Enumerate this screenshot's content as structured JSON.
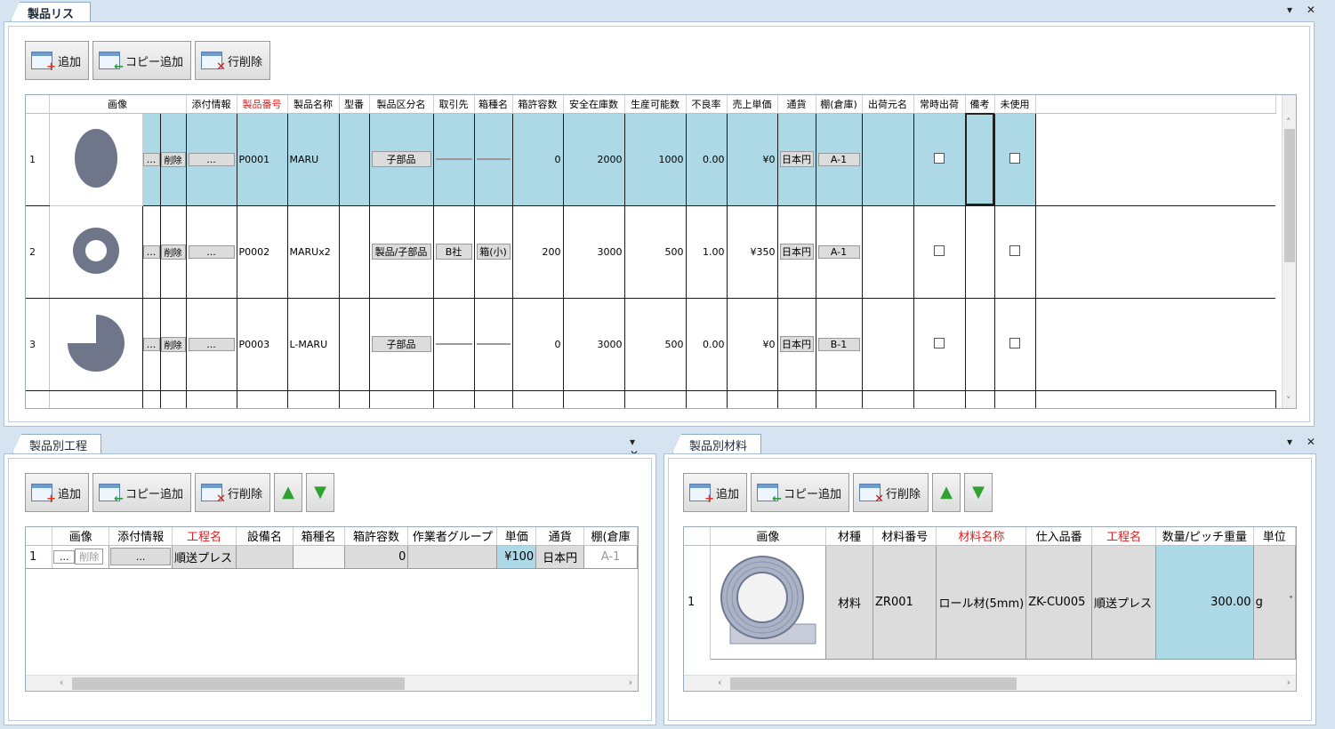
{
  "top_panel": {
    "title": "製品リスト",
    "controls": "▾ ✕",
    "toolbar": {
      "add": "追加",
      "copy_add": "コピー追加",
      "delete_row": "行削除"
    },
    "columns": [
      "画像",
      "添付情報",
      "製品番号",
      "製品名称",
      "型番",
      "製品区分名",
      "取引先",
      "箱種名",
      "箱許容数",
      "安全在庫数",
      "生産可能数",
      "不良率",
      "売上単価",
      "通貨",
      "棚(倉庫)",
      "出荷元名",
      "常時出荷",
      "備考",
      "未使用"
    ],
    "cell_buttons": {
      "ellipsis": "...",
      "delete": "削除"
    },
    "rows": [
      {
        "no": "1",
        "shape": "ellipse",
        "code": "P0001",
        "name": "MARU",
        "model": "",
        "category": "子部品",
        "partner": "",
        "box": "",
        "box_cap": "0",
        "safety": "2000",
        "capacity": "1000",
        "defect": "0.00",
        "price": "¥0",
        "currency": "日本円",
        "shelf": "A-1"
      },
      {
        "no": "2",
        "shape": "ring",
        "code": "P0002",
        "name": "MARUx2",
        "model": "",
        "category": "製品/子部品",
        "partner": "B社",
        "box": "箱(小)",
        "box_cap": "200",
        "safety": "3000",
        "capacity": "500",
        "defect": "1.00",
        "price": "¥350",
        "currency": "日本円",
        "shelf": "A-1"
      },
      {
        "no": "3",
        "shape": "pacman",
        "code": "P0003",
        "name": "L-MARU",
        "model": "",
        "category": "子部品",
        "partner": "",
        "box": "",
        "box_cap": "0",
        "safety": "3000",
        "capacity": "500",
        "defect": "0.00",
        "price": "¥0",
        "currency": "日本円",
        "shelf": "B-1"
      }
    ]
  },
  "process_panel": {
    "title": "製品別工程",
    "controls": "▾ ✕",
    "toolbar": {
      "add": "追加",
      "copy_add": "コピー追加",
      "delete_row": "行削除"
    },
    "columns": [
      "画像",
      "添付情報",
      "工程名",
      "設備名",
      "箱種名",
      "箱許容数",
      "作業者グループ",
      "単価",
      "通貨",
      "棚(倉庫"
    ],
    "row": {
      "no": "1",
      "ellipsis": "...",
      "delete": "削除",
      "attach": "...",
      "process": "順送プレス",
      "box_cap": "0",
      "price": "¥100",
      "currency": "日本円",
      "shelf": "A-1"
    }
  },
  "material_panel": {
    "title": "製品別材料",
    "controls": "▾ ✕",
    "toolbar": {
      "add": "追加",
      "copy_add": "コピー追加",
      "delete_row": "行削除"
    },
    "columns": [
      "画像",
      "材種",
      "材料番号",
      "材料名称",
      "仕入品番",
      "工程名",
      "数量/ピッチ重量",
      "単位"
    ],
    "row": {
      "no": "1",
      "kind": "材料",
      "mat_no": "ZR001",
      "mat_name": "ロール材(5mm)",
      "purchase": "ZK-CU005",
      "process": "順送プレス",
      "qty": "300.00",
      "unit": "g"
    }
  },
  "colors": {
    "selected": "#add8e6",
    "cell_gray": "#dcdcdc",
    "required_header": "#e0201e"
  }
}
